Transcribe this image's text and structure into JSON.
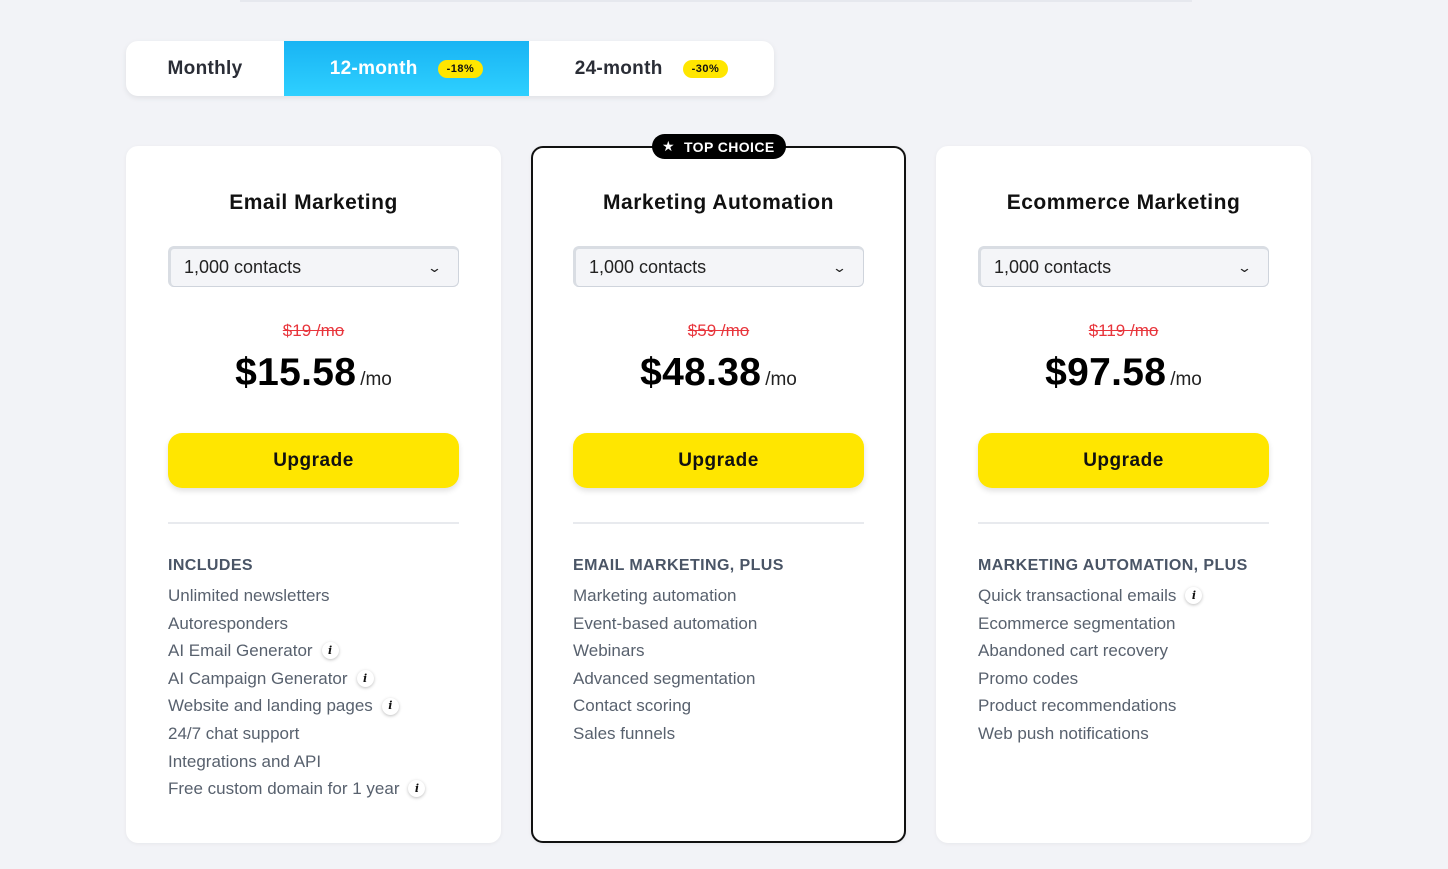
{
  "billing": {
    "tabs": [
      {
        "label": "Monthly",
        "discount": ""
      },
      {
        "label": "12-month",
        "discount": "-18%"
      },
      {
        "label": "24-month",
        "discount": "-30%"
      }
    ],
    "active": "12-month"
  },
  "badge": {
    "icon": "star-icon",
    "label": "TOP CHOICE"
  },
  "plans": [
    {
      "title": "Email Marketing",
      "contacts": "1,000 contacts",
      "old_price": "$19 /mo",
      "price": "$15.58",
      "per": "/mo",
      "cta": "Upgrade",
      "features_heading": "INCLUDES",
      "features": [
        {
          "text": "Unlimited newsletters",
          "info": false
        },
        {
          "text": "Autoresponders",
          "info": false
        },
        {
          "text": "AI Email Generator",
          "info": true
        },
        {
          "text": "AI Campaign Generator",
          "info": true
        },
        {
          "text": "Website and landing pages",
          "info": true
        },
        {
          "text": "24/7 chat support",
          "info": false
        },
        {
          "text": "Integrations and API",
          "info": false
        },
        {
          "text": "Free custom domain for 1 year",
          "info": true
        }
      ]
    },
    {
      "title": "Marketing Automation",
      "contacts": "1,000 contacts",
      "old_price": "$59 /mo",
      "price": "$48.38",
      "per": "/mo",
      "cta": "Upgrade",
      "features_heading": "EMAIL MARKETING, PLUS",
      "features": [
        {
          "text": "Marketing automation",
          "info": false
        },
        {
          "text": "Event-based automation",
          "info": false
        },
        {
          "text": "Webinars",
          "info": false
        },
        {
          "text": "Advanced segmentation",
          "info": false
        },
        {
          "text": "Contact scoring",
          "info": false
        },
        {
          "text": "Sales funnels",
          "info": false
        }
      ]
    },
    {
      "title": "Ecommerce Marketing",
      "contacts": "1,000 contacts",
      "old_price": "$119 /mo",
      "price": "$97.58",
      "per": "/mo",
      "cta": "Upgrade",
      "features_heading": "MARKETING AUTOMATION, PLUS",
      "features": [
        {
          "text": "Quick transactional emails",
          "info": true
        },
        {
          "text": "Ecommerce segmentation",
          "info": false
        },
        {
          "text": "Abandoned cart recovery",
          "info": false
        },
        {
          "text": "Promo codes",
          "info": false
        },
        {
          "text": "Product recommendations",
          "info": false
        },
        {
          "text": "Web push notifications",
          "info": false
        }
      ]
    }
  ],
  "icons": {
    "info": "info-icon",
    "chevron": "chevron-down-icon",
    "info_glyph": "i",
    "chevron_glyph": "⌄"
  },
  "colors": {
    "accent_yellow": "#ffe600",
    "active_tab": "#19b4f4",
    "strike_red": "#e8353c"
  }
}
